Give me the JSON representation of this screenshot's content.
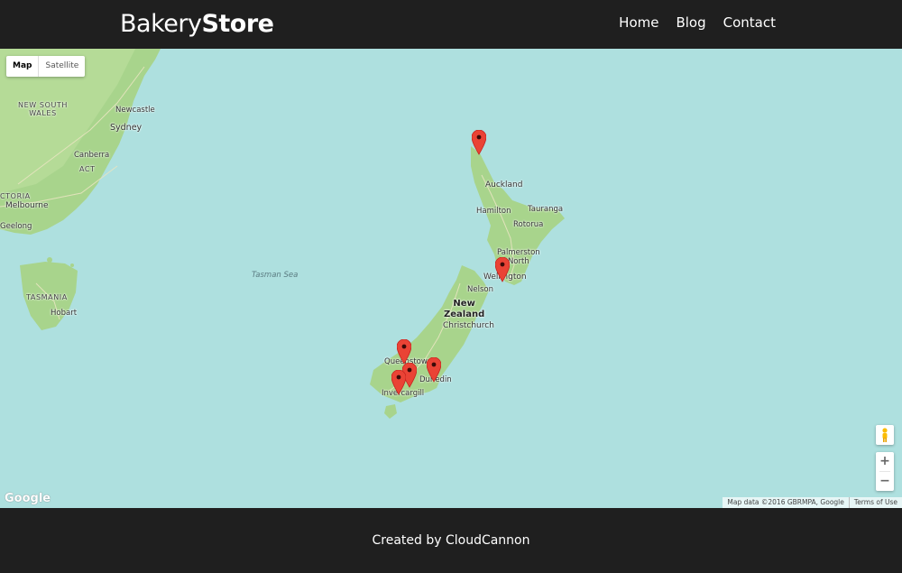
{
  "header": {
    "logo_light": "Bakery",
    "logo_bold": "Store",
    "nav": [
      "Home",
      "Blog",
      "Contact"
    ]
  },
  "map": {
    "type_controls": [
      "Map",
      "Satellite"
    ],
    "selected_type": "Map",
    "labels": {
      "new_south_wales": "NEW SOUTH\nWALES",
      "newcastle": "Newcastle",
      "sydney": "Sydney",
      "canberra": "Canberra",
      "act": "ACT",
      "victoria": "CTORIA",
      "melbourne": "Melbourne",
      "geelong": "Geelong",
      "tasmania": "TASMANIA",
      "hobart": "Hobart",
      "tasman_sea": "Tasman Sea",
      "auckland": "Auckland",
      "hamilton": "Hamilton",
      "tauranga": "Tauranga",
      "rotorua": "Rotorua",
      "palmerston_north": "Palmerston\nNorth",
      "wellington": "Wellington",
      "nelson": "Nelson",
      "new_zealand": "New\nZealand",
      "christchurch": "Christchurch",
      "queenstown": "Queenstown",
      "dunedin": "Dunedin",
      "invercargill": "Invercargill"
    },
    "pin_color": "#ea4335",
    "zoom_in": "+",
    "zoom_out": "−",
    "logo": "Google",
    "attribution": "Map data ©2016 GBRMPA, Google",
    "terms": "Terms of Use"
  },
  "footer": {
    "credit": "Created by CloudCannon"
  }
}
